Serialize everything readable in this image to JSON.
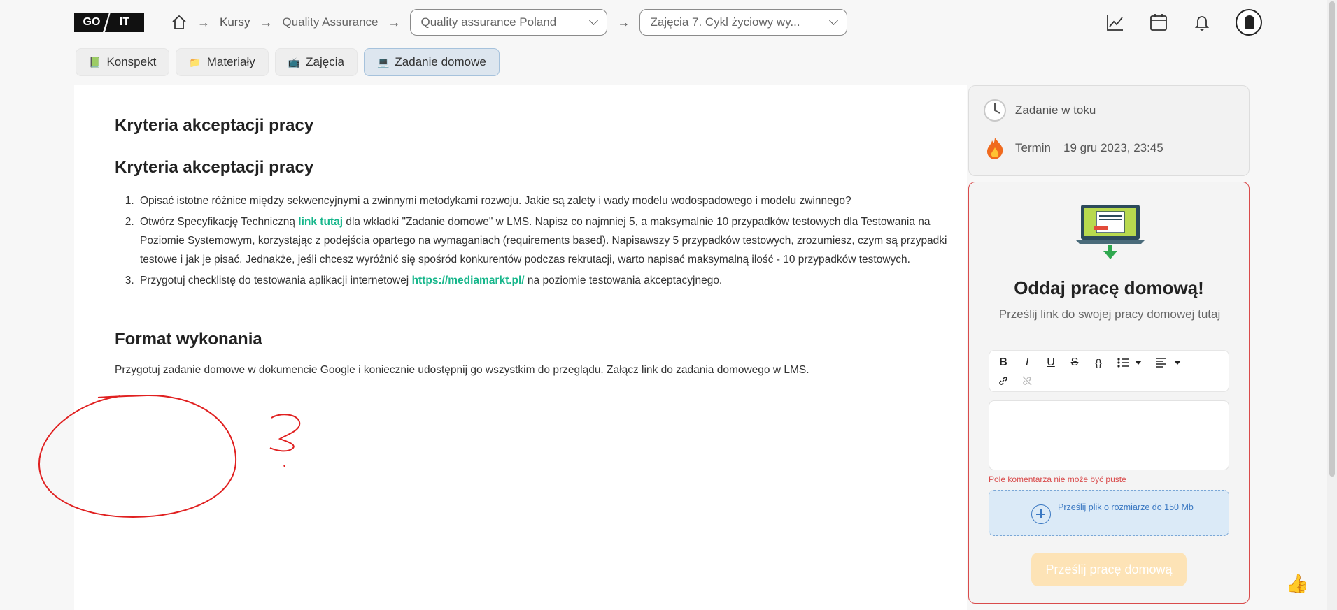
{
  "logo": {
    "part1": "GO",
    "part2": "IT"
  },
  "breadcrumb": {
    "home_icon": "home-icon",
    "courses": "Kursy",
    "program": "Quality Assurance",
    "group_select": "Quality assurance Poland",
    "lesson_select": "Zajęcia 7. Cykl życiowy wy..."
  },
  "header_icons": [
    "chart-icon",
    "calendar-icon",
    "bell-icon",
    "avatar"
  ],
  "tabs": [
    {
      "icon": "📗",
      "label": "Konspekt"
    },
    {
      "icon": "📁",
      "label": "Materiały"
    },
    {
      "icon": "📺",
      "label": "Zajęcia"
    },
    {
      "icon": "💻",
      "label": "Zadanie domowe"
    }
  ],
  "content": {
    "heading1": "Kryteria akceptacji pracy",
    "heading2": "Kryteria akceptacji pracy",
    "item1": "Opisać istotne różnice między sekwencyjnymi a zwinnymi metodykami rozwoju. Jakie są zalety i wady modelu wodospadowego i modelu zwinnego?",
    "item2_before": "Otwórz Specyfikację Techniczną ",
    "item2_link": "link tutaj",
    "item2_after": " dla wkładki \"Zadanie domowe\" w LMS. Napisz co najmniej 5, a maksymalnie 10 przypadków testowych dla Testowania na Poziomie Systemowym, korzystając z podejścia opartego na wymaganiach (requirements based). Napisawszy 5 przypadków testowych, zrozumiesz, czym są przypadki testowe i jak je pisać. Jednakże, jeśli chcesz wyróżnić się spośród konkurentów podczas rekrutacji, warto napisać maksymalną ilość - 10 przypadków testowych.",
    "item3_before": "Przygotuj checklistę do testowania aplikacji internetowej ",
    "item3_link": "https://mediamarkt.pl/",
    "item3_after": " na poziomie testowania akceptacyjnego.",
    "heading3": "Format wykonania",
    "format_text": "Przygotuj zadanie domowe w dokumencie Google i koniecznie udostępnij go wszystkim do przeglądu. Załącz link do zadania domowego w LMS."
  },
  "status": {
    "state_icon": "clock-icon",
    "state": "Zadanie w toku",
    "deadline_icon": "fire-icon",
    "deadline_label": "Termin",
    "deadline_value": "19 gru 2023, 23:45"
  },
  "homework": {
    "title": "Oddaj pracę domową!",
    "subtitle": "Prześlij link do swojej pracy domowej tutaj",
    "toolbar": [
      "B",
      "I",
      "U",
      "S",
      "{}",
      "list",
      "align",
      "link",
      "unlink"
    ],
    "error": "Pole komentarza nie może być puste",
    "upload_text": "Prześlij plik o rozmiarze do 150 Mb",
    "submit": "Prześlij pracę domową"
  },
  "colors": {
    "accent_green": "#17b68b",
    "error_red": "#d94b4b",
    "upload_blue": "#3a78c2",
    "submit_disabled": "#fde3b6"
  }
}
